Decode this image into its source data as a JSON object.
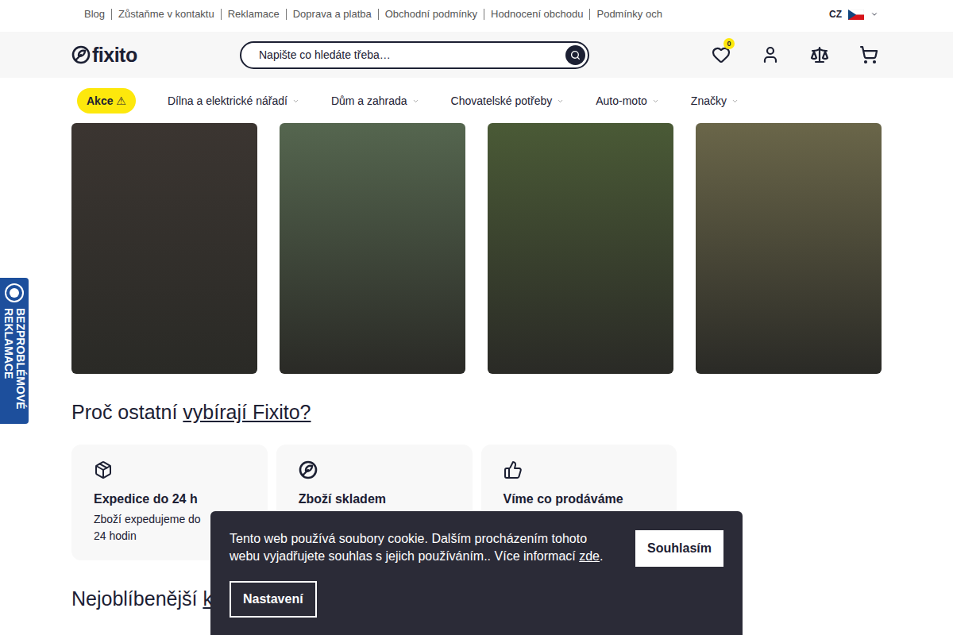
{
  "topbar": {
    "links": [
      "Blog",
      "Zůstaňme v kontaktu",
      "Reklamace",
      "Doprava a platba",
      "Obchodní podmínky",
      "Hodnocení obchodu",
      "Podmínky och"
    ],
    "language": "CZ"
  },
  "header": {
    "logo": "fixito",
    "search": {
      "placeholder": "Napište co hledáte třeba…"
    },
    "wishlist_count": "0"
  },
  "nav": {
    "items": [
      {
        "label": "Akce ⚠",
        "highlighted": true
      },
      {
        "label": "Dílna a elektrické nářadí",
        "highlighted": false
      },
      {
        "label": "Dům a zahrada",
        "highlighted": false
      },
      {
        "label": "Chovatelské potřeby",
        "highlighted": false
      },
      {
        "label": "Auto-moto",
        "highlighted": false
      },
      {
        "label": "Značky",
        "highlighted": false
      }
    ]
  },
  "banners": [
    {
      "color": "#3b3531"
    },
    {
      "color": "#55664f"
    },
    {
      "color": "#4a5a36"
    },
    {
      "color": "#6a6649"
    }
  ],
  "side_badge": {
    "lines": [
      "BEZPROBLÉMOVÉ",
      "REKLAMACE"
    ]
  },
  "why": {
    "title": "Proč ostatní ",
    "title_link": "vybírají Fixito?",
    "cards": [
      {
        "title": "Expedice do 24 h",
        "text": "Zboží expedujeme do 24 hodin"
      },
      {
        "title": "Zboží skladem",
        "text": ""
      },
      {
        "title": "Víme co prodáváme",
        "text": ""
      }
    ]
  },
  "popular": {
    "title": "Nejoblíbenější ",
    "title_link": "ka"
  },
  "cookie": {
    "text": "Tento web používá soubory cookie. Dalším procházením tohoto webu vyjadřujete souhlas s jejich používáním.. Více informací ",
    "link": "zde",
    "after": ".",
    "accept": "Souhlasím",
    "settings": "Nastavení"
  }
}
